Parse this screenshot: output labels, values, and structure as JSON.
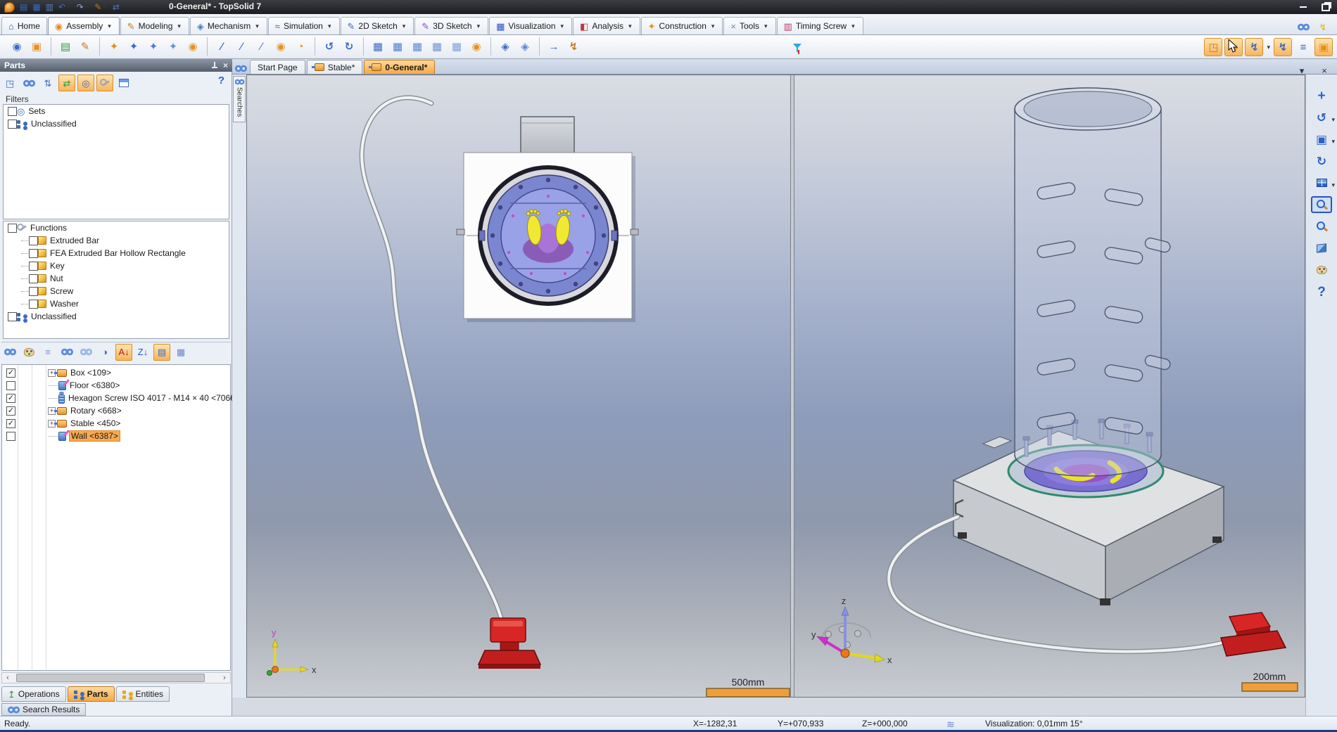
{
  "window": {
    "title": "0-General* - TopSolid 7"
  },
  "quick_access": [
    {
      "name": "topsolid-logo",
      "cls": "i-logo"
    },
    {
      "name": "save",
      "glyph": "▤",
      "c": "#3a68c4"
    },
    {
      "name": "save-all",
      "glyph": "▦",
      "c": "#3a68c4"
    },
    {
      "name": "print",
      "glyph": "▥",
      "c": "#5a7eb8"
    },
    {
      "name": "undo",
      "glyph": "↶",
      "c": "#3a68c4",
      "dd": true
    },
    {
      "name": "redo",
      "glyph": "↷",
      "c": "#8aa4cc",
      "dd": true
    },
    {
      "name": "edit",
      "glyph": "✎",
      "c": "#c8781c",
      "dd": true
    },
    {
      "name": "refresh",
      "glyph": "⇄",
      "c": "#4a7ac0"
    }
  ],
  "window_buttons": [
    {
      "name": "minimize"
    },
    {
      "name": "restore"
    }
  ],
  "ribbon_tabs": [
    {
      "label": "Home",
      "glyph": "⌂",
      "c": "#2a5fc0"
    },
    {
      "label": "Assembly",
      "glyph": "◉",
      "c": "#e88818",
      "dd": true,
      "active": true
    },
    {
      "label": "Modeling",
      "glyph": "✎",
      "c": "#c07818",
      "dd": true
    },
    {
      "label": "Mechanism",
      "glyph": "◈",
      "c": "#4a78c8",
      "dd": true
    },
    {
      "label": "Simulation",
      "glyph": "≈",
      "c": "#3a6ac0",
      "dd": true
    },
    {
      "label": "2D Sketch",
      "glyph": "✎",
      "c": "#3a6ac0",
      "dd": true
    },
    {
      "label": "3D Sketch",
      "glyph": "✎",
      "c": "#8a4ac0",
      "dd": true
    },
    {
      "label": "Visualization",
      "glyph": "▦",
      "c": "#2a52c8",
      "dd": true
    },
    {
      "label": "Analysis",
      "glyph": "◧",
      "c": "#c03a3a",
      "dd": true
    },
    {
      "label": "Construction",
      "glyph": "✦",
      "c": "#e89018",
      "dd": true
    },
    {
      "label": "Tools",
      "glyph": "×",
      "c": "#7a8494",
      "dd": true
    },
    {
      "label": "Timing Screw",
      "glyph": "▥",
      "c": "#c03a6a",
      "dd": true
    }
  ],
  "ribbon_right": [
    {
      "name": "quick-search",
      "cls": "i-eyes"
    },
    {
      "name": "search-flash",
      "glyph": "↯",
      "c": "#e8b400"
    }
  ],
  "main_toolbar": {
    "groups": [
      [
        [
          "inclusion",
          "◉",
          "#3a6cc4"
        ],
        [
          "multiple-inclusion",
          "▣",
          "#e8901c"
        ]
      ],
      [
        [
          "document-check",
          "▤",
          "#2f9a3a"
        ],
        [
          "modify-in-place",
          "✎",
          "#c8781c"
        ]
      ],
      [
        [
          "positioning",
          "✦",
          "#e8901c"
        ],
        [
          "point-positioning",
          "✦",
          "#3a6cc4"
        ],
        [
          "axis-positioning",
          "✦",
          "#4a7cd0"
        ],
        [
          "plane-positioning",
          "✦",
          "#6a94d8"
        ],
        [
          "advanced-positioning",
          "◉",
          "#e8901c"
        ]
      ],
      [
        [
          "axis-constraint",
          "∕",
          "#3a6cc4"
        ],
        [
          "parallel-constraint",
          "∕",
          "#4a7cd0"
        ],
        [
          "angle-constraint",
          "∕",
          "#6a94d8"
        ],
        [
          "tangent-constraint",
          "◉",
          "#e8901c"
        ],
        [
          "distance-constraint",
          "◔",
          "#e8901c"
        ]
      ],
      [
        [
          "rigid-group",
          "↺",
          "#3a6cc4"
        ],
        [
          "flexible-group",
          "↻",
          "#3a6cc4"
        ]
      ],
      [
        [
          "publish-part",
          "▦",
          "#3a6cc4"
        ],
        [
          "publish-set",
          "▦",
          "#4a7cd0"
        ],
        [
          "publish-function",
          "▦",
          "#5a88d4"
        ],
        [
          "publish-frame",
          "▦",
          "#6a94d8"
        ],
        [
          "publish-axis",
          "▦",
          "#7aa0dc"
        ],
        [
          "publish-plane",
          "◉",
          "#e8901c"
        ]
      ],
      [
        [
          "orient-view",
          "◈",
          "#3a6cc4"
        ],
        [
          "reverse-orientation",
          "◈",
          "#5a88d4"
        ]
      ],
      [
        [
          "measure",
          "→",
          "#3a6cc4"
        ],
        [
          "analyze-assembly",
          "↯",
          "#c8781c"
        ]
      ]
    ],
    "filter": {
      "name": "selection-filter",
      "cls": "i-funnel"
    },
    "right": [
      {
        "name": "select-set",
        "glyph": "◳",
        "c": "#c8781c",
        "accent": true
      },
      {
        "name": "tag-part",
        "glyph": "◆",
        "c": "#e8901c",
        "accent": true
      },
      {
        "name": "assembly-function",
        "glyph": "↯",
        "c": "#3a6cc4",
        "accent": true,
        "dd": true
      },
      {
        "name": "screw-function",
        "glyph": "↯",
        "c": "#2f6ac4",
        "accent": true
      },
      {
        "name": "tree-window",
        "glyph": "≡",
        "c": "#3a6cc4"
      },
      {
        "name": "bom-window",
        "glyph": "▣",
        "c": "#e8901c",
        "accent": true
      }
    ]
  },
  "parts_panel": {
    "title": "Parts",
    "help_label": "?",
    "toolbar": [
      {
        "name": "select-in-tree",
        "glyph": "◳",
        "c": "#3a6cc4"
      },
      {
        "name": "search",
        "cls": "i-eyes"
      },
      {
        "name": "dimension-display",
        "glyph": "⇅",
        "c": "#3a6cc4"
      },
      {
        "name": "sort-mode",
        "glyph": "⇄",
        "c": "#2f9a3a",
        "accent": true
      },
      {
        "name": "sets-display",
        "glyph": "◎",
        "c": "#3a6cc4",
        "accent": true
      },
      {
        "name": "functions-display",
        "cls": "i-wrench",
        "accent": true
      },
      {
        "name": "columns",
        "cls": "i-columns"
      }
    ],
    "filters_label": "Filters",
    "filters": [
      {
        "label": "Sets",
        "glyph": "◎",
        "c": "#3a6cc4",
        "checked": false
      },
      {
        "label": "Unclassified",
        "cls": "i-tree",
        "checked": false
      }
    ],
    "functions": [
      {
        "label": "Functions",
        "depth": 0,
        "cls": "i-wrench",
        "checked": false
      },
      {
        "label": "Extruded Bar",
        "depth": 1,
        "cls": "i-cube",
        "checked": false
      },
      {
        "label": "FEA Extruded Bar Hollow Rectangle",
        "depth": 1,
        "cls": "i-cube",
        "checked": false
      },
      {
        "label": "Key",
        "depth": 1,
        "cls": "i-cube",
        "checked": false
      },
      {
        "label": "Nut",
        "depth": 1,
        "cls": "i-cube",
        "checked": false
      },
      {
        "label": "Screw",
        "depth": 1,
        "cls": "i-cube",
        "checked": false
      },
      {
        "label": "Washer",
        "depth": 1,
        "cls": "i-cube",
        "checked": false
      },
      {
        "label": "Unclassified",
        "depth": 0,
        "cls": "i-tree",
        "checked": false
      }
    ],
    "grid_toolbar": [
      {
        "name": "visibility-all",
        "cls": "i-eyes"
      },
      {
        "name": "colors",
        "cls": "i-palette"
      },
      {
        "name": "layers",
        "glyph": "≡",
        "c": "#7a98c8"
      },
      {
        "name": "show-parts",
        "cls": "i-eyes"
      },
      {
        "name": "show-hidden",
        "cls": "i-eyes dim"
      },
      {
        "name": "show-section",
        "glyph": "◑",
        "c": "#3a6cc4"
      },
      {
        "name": "sort-az",
        "glyph": "A↓",
        "c": "#b02020",
        "accent": true
      },
      {
        "name": "sort-za",
        "glyph": "Z↓",
        "c": "#2a52c8"
      },
      {
        "name": "tree-display",
        "glyph": "▤",
        "c": "#3a6cc4",
        "accent": true
      },
      {
        "name": "display-options",
        "glyph": "▦",
        "c": "#6a88c4"
      }
    ],
    "parts": [
      {
        "label": "Box <109>",
        "checked": true,
        "expand": true,
        "icon": "i-part"
      },
      {
        "label": "Floor <6380>",
        "checked": false,
        "expand": false,
        "icon": "i-part-edit"
      },
      {
        "label": "Hexagon Screw ISO 4017 - M14 × 40 <7066",
        "checked": true,
        "expand": false,
        "icon": "i-screw"
      },
      {
        "label": "Rotary <668>",
        "checked": true,
        "expand": true,
        "icon": "i-part"
      },
      {
        "label": "Stable <450>",
        "checked": true,
        "expand": true,
        "icon": "i-part"
      },
      {
        "label": "Wall <6387>",
        "checked": false,
        "expand": false,
        "icon": "i-part-edit",
        "selected": true
      }
    ],
    "bottom_tabs": [
      {
        "label": "Operations",
        "glyph": "↥",
        "c": "#2f9a3a"
      },
      {
        "label": "Parts",
        "cls": "i-tree",
        "active": true
      },
      {
        "label": "Entities",
        "cls": "i-tree yellow"
      }
    ],
    "search_tab": {
      "label": "Search Results",
      "cls": "i-eyes"
    }
  },
  "document_tabs": [
    {
      "label": "Start Page"
    },
    {
      "label": "Stable*",
      "icon": "i-part"
    },
    {
      "label": "0-General*",
      "icon": "i-part",
      "active": true
    }
  ],
  "tabbar_right": [
    {
      "name": "tab-list",
      "glyph": "▾"
    },
    {
      "name": "close-document",
      "glyph": "×"
    }
  ],
  "viewport": {
    "searches_label": "Searches",
    "left_scale": "500mm",
    "right_scale": "200mm",
    "axes": {
      "x": "x",
      "y": "y",
      "z": "z"
    }
  },
  "right_toolbar": [
    {
      "name": "pan",
      "glyph": "+",
      "c": "#2a62c8",
      "big": true
    },
    {
      "name": "orbit",
      "glyph": "↺",
      "c": "#2a62c8",
      "dd": true
    },
    {
      "name": "zoom-extent",
      "glyph": "▣",
      "c": "#2a62c8",
      "dd": true
    },
    {
      "name": "rotate-view",
      "glyph": "↻",
      "c": "#2a62c8"
    },
    {
      "name": "split-viewport",
      "cls": "i-split",
      "dd": true
    },
    {
      "name": "zoom-window",
      "cls": "i-mag",
      "selected": true
    },
    {
      "name": "magnifier",
      "cls": "i-mag"
    },
    {
      "name": "isometric-view",
      "cls": "i-box3d"
    },
    {
      "name": "render-options",
      "cls": "i-palette"
    },
    {
      "name": "help",
      "glyph": "?",
      "c": "#2a5fc0",
      "big": true
    }
  ],
  "status_bar": {
    "ready": "Ready.",
    "coord_x": "X=-1282,31",
    "coord_y": "Y=+070,933",
    "coord_z": "Z=+000,000",
    "visualization": "Visualization: 0,01mm 15°"
  }
}
